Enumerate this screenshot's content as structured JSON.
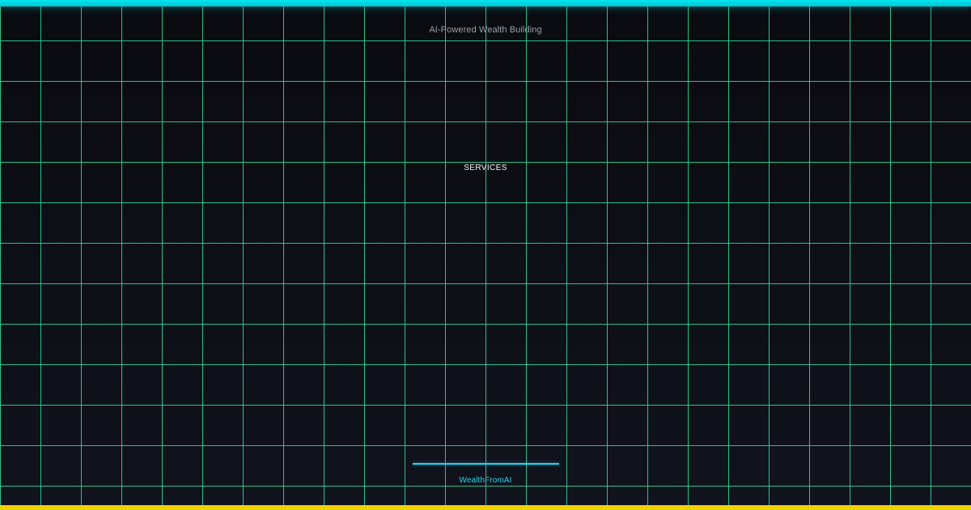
{
  "header": {
    "tagline": "AI-Powered Wealth Building"
  },
  "main": {
    "section_label": "SERVICES"
  },
  "footer": {
    "brand_name": "WealthFromAI"
  },
  "colors": {
    "accent_cyan": "#00E6F0",
    "grid_green": "#2DE1A0",
    "accent_yellow": "#F2D100",
    "background": "#0A0B10"
  }
}
